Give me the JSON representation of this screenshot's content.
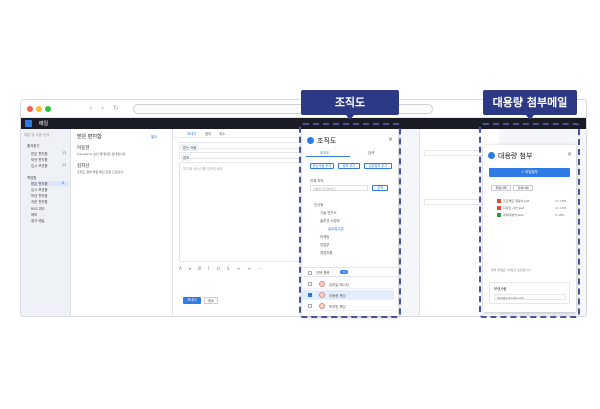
{
  "app": {
    "title": "메일"
  },
  "left": {
    "search_placeholder": "메일 및 사용 검색",
    "items": [
      {
        "label": "즐겨찾기",
        "count": ""
      },
      {
        "label": "받은 편지함",
        "count": "13"
      },
      {
        "label": "보낸 편지함",
        "count": ""
      },
      {
        "label": "임시 보관함",
        "count": "12"
      },
      {
        "label": "백업함",
        "count": ""
      },
      {
        "label": "받은 편지함",
        "count": "6"
      },
      {
        "label": "임시 보관함",
        "count": ""
      },
      {
        "label": "보낸 편지함",
        "count": ""
      },
      {
        "label": "지운 편지함",
        "count": ""
      },
      {
        "label": "RSS 피드",
        "count": ""
      },
      {
        "label": "메모",
        "count": ""
      },
      {
        "label": "정크 메일",
        "count": ""
      }
    ]
  },
  "mail_list": {
    "title": "받은 편지함",
    "filter": "필터",
    "items": [
      {
        "sender": "이동현",
        "preview": "sns.app.io 보안 업데이트 안내입니다"
      },
      {
        "sender": "김지선",
        "preview": "조직도 첨부 파일 확인 요청 드립니다"
      }
    ]
  },
  "compose": {
    "toolbar": [
      "보내기",
      "첨부",
      "취소"
    ],
    "to_label": "받는 사람",
    "cc_label": "참조",
    "body_placeholder": "여기에 메시지를 입력하세요",
    "send": "보내기",
    "discard": "취소"
  },
  "org_panel": {
    "title": "조직도",
    "tabs": [
      "조직도",
      "검색"
    ],
    "buttons": [
      "받는사람 추가",
      "참조 추가",
      "숨은참조 추가"
    ],
    "dept_select": "전체 조직",
    "search_placeholder": "이름을 입력하세요",
    "search_btn": "검색",
    "tree": [
      "인사팀",
      "기술 연구소",
      "솔루션 사업부",
      "글로벌사업",
      "마케팅",
      "영업부",
      "경영지원"
    ],
    "members_header": "선택 항목",
    "members_count": "34",
    "members": [
      "김하늘 매니저",
      "이동현 책임",
      "박지민 책임"
    ]
  },
  "attach_panel": {
    "title": "대용량 첨부",
    "upload_btn": "파일첨부",
    "actions": [
      "파일삭제",
      "전체삭제"
    ],
    "files": [
      {
        "name": "프로젝트 계획서.pdf",
        "size": "15.3MB"
      },
      {
        "name": "디자인 시안.psd",
        "size": "22.1MB"
      },
      {
        "name": "데이터분석.xlsx",
        "size": "8.4MB"
      }
    ],
    "note": "첨부 파일은 30일간 보관됩니다",
    "sender_label": "보낸사람",
    "sender_value": "test@ycpinet.com"
  },
  "callouts": {
    "org": "조직도",
    "attach": "대용량 첨부메일"
  },
  "colors": {
    "accent": "#2f7be5",
    "callout": "#2c3a86",
    "appbar": "#1b1b25"
  }
}
